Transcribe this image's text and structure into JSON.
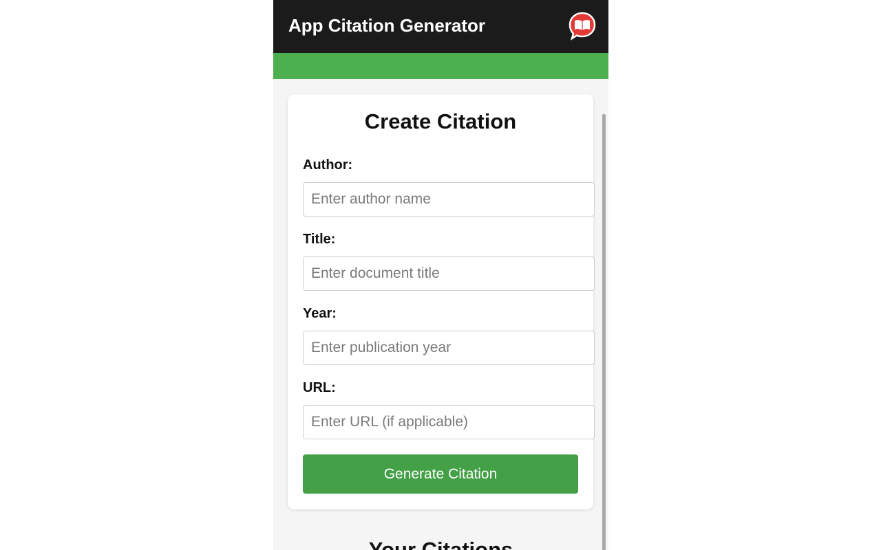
{
  "header": {
    "title": "App Citation Generator",
    "icon": "book-chat-bubble-icon",
    "background": "#1b1b1b"
  },
  "accent_color": "#4caf50",
  "form": {
    "title": "Create Citation",
    "fields": [
      {
        "label": "Author:",
        "placeholder": "Enter author name",
        "value": ""
      },
      {
        "label": "Title:",
        "placeholder": "Enter document title",
        "value": ""
      },
      {
        "label": "Year:",
        "placeholder": "Enter publication year",
        "value": ""
      },
      {
        "label": "URL:",
        "placeholder": "Enter URL (if applicable)",
        "value": ""
      }
    ],
    "submit_label": "Generate Citation",
    "submit_color": "#43a047"
  },
  "citations": {
    "title": "Your Citations"
  }
}
